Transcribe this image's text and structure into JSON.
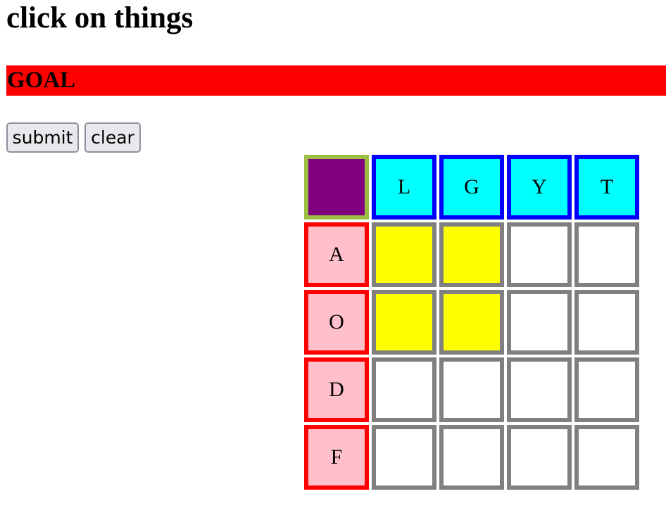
{
  "page": {
    "title": "click on things",
    "goal_label": "GOAL"
  },
  "buttons": {
    "submit": "submit",
    "clear": "clear"
  },
  "grid": {
    "columns": [
      "L",
      "G",
      "Y",
      "T"
    ],
    "rows": [
      {
        "label": "A",
        "cells": [
          "yellow",
          "yellow",
          "white",
          "white"
        ]
      },
      {
        "label": "O",
        "cells": [
          "yellow",
          "yellow",
          "white",
          "white"
        ]
      },
      {
        "label": "D",
        "cells": [
          "white",
          "white",
          "white",
          "white"
        ]
      },
      {
        "label": "F",
        "cells": [
          "white",
          "white",
          "white",
          "white"
        ]
      }
    ]
  },
  "colors": {
    "goal_background": "#ff0000",
    "corner_fill": "#800080",
    "corner_border": "#9bbd43",
    "column_header_fill": "#00ffff",
    "column_header_border": "#0000ff",
    "row_header_fill": "#ffc0cb",
    "row_header_border": "#ff0000",
    "cell_border": "#808080",
    "cell_selected": "#ffff00",
    "cell_empty": "#ffffff"
  }
}
